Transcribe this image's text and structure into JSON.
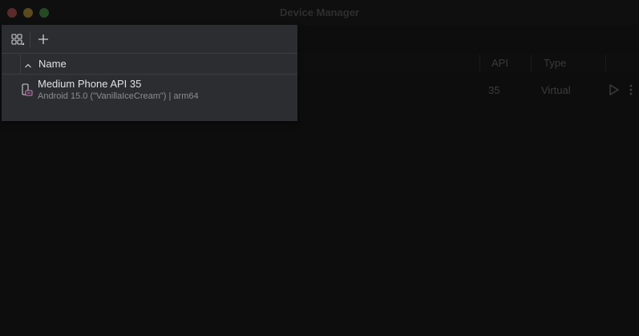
{
  "window": {
    "title": "Device Manager"
  },
  "toolbar": {
    "grid_icon": "device-grid-icon",
    "add_icon": "plus-icon"
  },
  "table": {
    "columns": {
      "name": "Name",
      "api": "API",
      "type": "Type"
    },
    "sort_icon": "chevron-up-icon"
  },
  "devices": [
    {
      "name": "Medium Phone API 35",
      "subtitle": "Android 15.0 (\"VanillaIceCream\") | arm64",
      "api": "35",
      "type": "Virtual",
      "icon": "phone-device-icon"
    }
  ],
  "actions": {
    "run_icon": "play-icon",
    "more_icon": "kebab-menu-icon"
  },
  "colors": {
    "panel_bg": "#2b2d30",
    "window_bg": "#0d0d0d",
    "text_primary": "#dfe1e5",
    "text_secondary": "#8a8d93",
    "device_icon_accent": "#c77dbb"
  }
}
